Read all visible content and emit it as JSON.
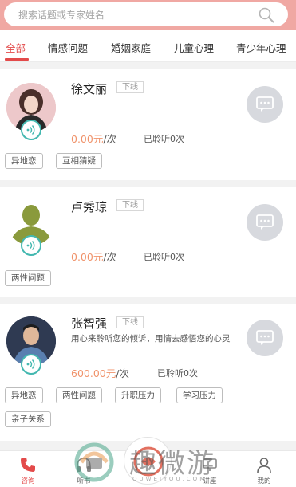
{
  "search": {
    "placeholder": "搜索话题或专家姓名",
    "icon": "search-icon"
  },
  "tabs": [
    {
      "label": "全部",
      "active": true
    },
    {
      "label": "情感问题",
      "active": false
    },
    {
      "label": "婚姻家庭",
      "active": false
    },
    {
      "label": "儿童心理",
      "active": false
    },
    {
      "label": "青少年心理",
      "active": false
    }
  ],
  "experts": [
    {
      "name": "徐文丽",
      "status": "下线",
      "price": "0.00元",
      "unit": "/次",
      "listened": "已聆听0次",
      "tags": [
        "异地恋",
        "互相猜疑"
      ]
    },
    {
      "name": "卢秀琼",
      "status": "下线",
      "price": "0.00元",
      "unit": "/次",
      "listened": "已聆听0次",
      "tags": [
        "两性问题"
      ]
    },
    {
      "name": "张智强",
      "status": "下线",
      "intro": "用心来聆听您的倾诉，用情去感悟您的心灵",
      "price": "600.00元",
      "unit": "/次",
      "listened": "已聆听0次",
      "tags": [
        "异地恋",
        "两性问题",
        "升职压力",
        "学习压力",
        "亲子关系"
      ]
    }
  ],
  "bottom_nav": [
    {
      "label": "咨询",
      "icon": "phone-icon",
      "active": true
    },
    {
      "label": "听书",
      "icon": "headset-icon",
      "active": false
    },
    {
      "label": "讲座",
      "icon": "lecture-icon",
      "active": false
    },
    {
      "label": "我的",
      "icon": "user-icon",
      "active": false
    }
  ],
  "watermark": {
    "text": "趣微游",
    "sub": "QUWEIYOU.COM"
  },
  "colors": {
    "accent": "#e34a4a",
    "price": "#f0936b",
    "header_bg": "#f0a8a3",
    "voice_ring": "#44b8b0"
  }
}
